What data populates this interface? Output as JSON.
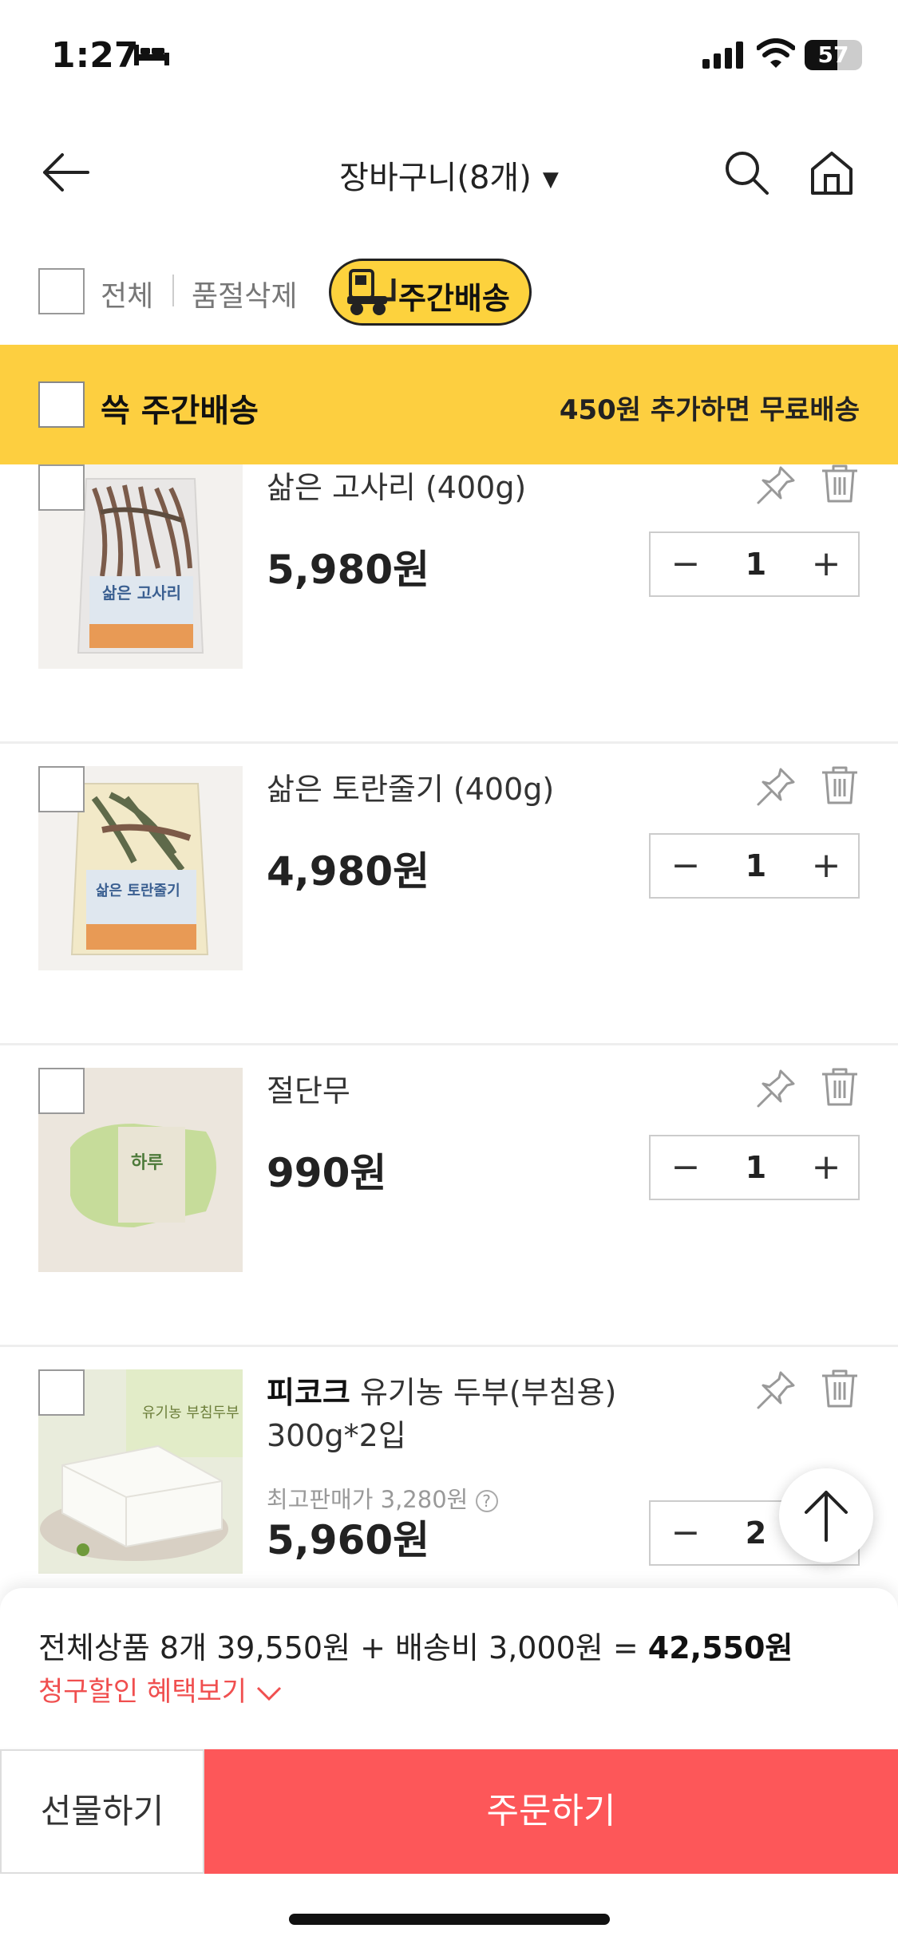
{
  "status_bar": {
    "time": "1:27",
    "battery": "57",
    "battery_level": 0.57
  },
  "header": {
    "title": "장바구니(8개)",
    "caret": "▼"
  },
  "filters": {
    "select_all_label": "전체",
    "delete_soldout_label": "품절삭제",
    "weekly_badge_label": "주간배송"
  },
  "weekly_section": {
    "title": "쓱 주간배송",
    "free_shipping_notice": "450원 추가하면 무료배송"
  },
  "cart_items": [
    {
      "brand": "",
      "name": "삶은 고사리 (400g)",
      "price": "5,980원",
      "quantity": "1",
      "image_label": "삶은 고사리"
    },
    {
      "brand": "",
      "name": "삶은 토란줄기 (400g)",
      "price": "4,980원",
      "quantity": "1",
      "image_label": "삶은 토란줄기"
    },
    {
      "brand": "",
      "name": "절단무",
      "price": "990원",
      "quantity": "1",
      "image_label": "하루"
    },
    {
      "brand": "피코크",
      "name": " 유기농 두부(부침용) 300g*2입",
      "original_price": "최고판매가 3,280원",
      "info_icon": "?",
      "price": "5,960원",
      "quantity": "2",
      "image_label": "유기농 부침두부"
    }
  ],
  "stepper": {
    "minus": "−",
    "plus": "+"
  },
  "summary": {
    "text": "전체상품 8개 39,550원 + 배송비 3,000원 = ",
    "total": "42,550원",
    "discount_link": "청구할인 혜택보기"
  },
  "actions": {
    "gift_label": "선물하기",
    "order_label": "주문하기"
  },
  "colors": {
    "accent_yellow": "#fdcf40",
    "order_red": "#fd5759",
    "discount_red": "#f04f4f"
  }
}
